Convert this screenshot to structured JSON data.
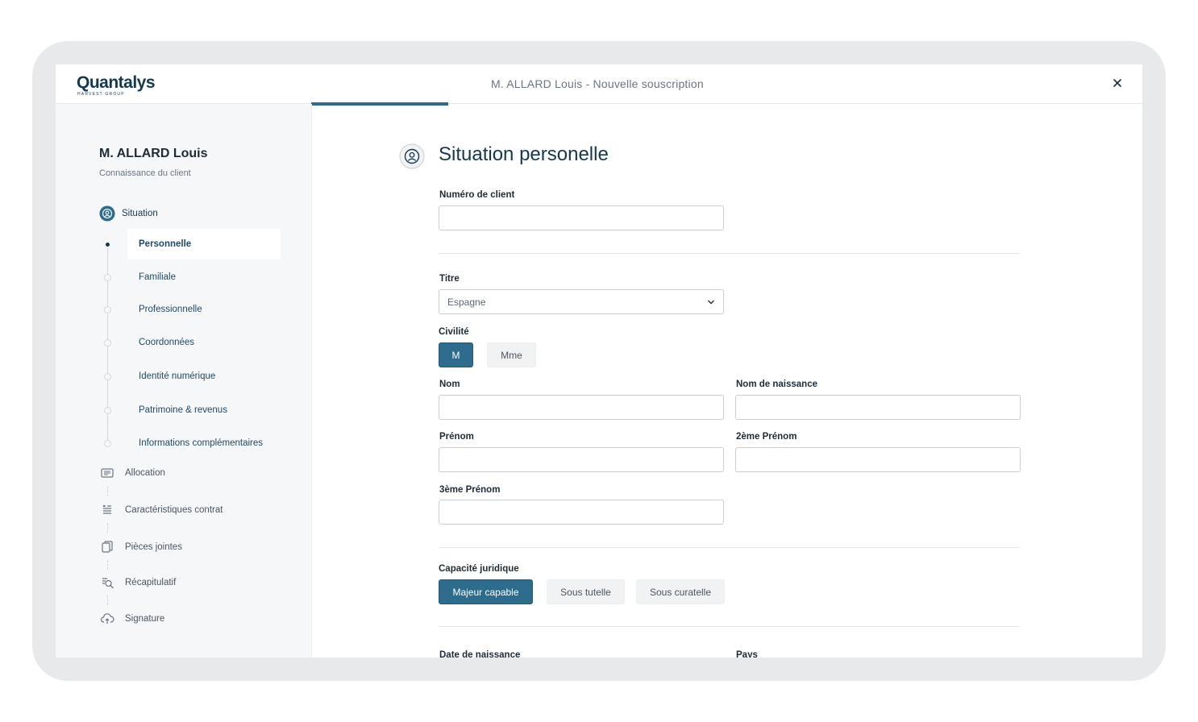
{
  "app": {
    "logo_text": "Quantalys",
    "logo_sub": "HARVEST GROUP",
    "window_title": "M. ALLARD Louis - Nouvelle souscription",
    "progress": 0.165
  },
  "sidebar": {
    "client_name": "M. ALLARD Louis",
    "client_subtitle": "Connaissance du client",
    "situation_label": "Situation",
    "sub_items": [
      {
        "label": "Personnelle",
        "active": true
      },
      {
        "label": "Familiale"
      },
      {
        "label": "Professionnelle"
      },
      {
        "label": "Coordonnées"
      },
      {
        "label": "Identité numérique"
      },
      {
        "label": "Patrimoine & revenus"
      },
      {
        "label": "Informations complémentaires"
      }
    ],
    "steps": [
      {
        "label": "Allocation",
        "icon": "allocation-icon"
      },
      {
        "label": "Caractéristiques contrat",
        "icon": "contract-list-icon"
      },
      {
        "label": "Pièces jointes",
        "icon": "attachments-icon"
      },
      {
        "label": "Récapitulatif",
        "icon": "summary-search-icon"
      },
      {
        "label": "Signature",
        "icon": "cloud-upload-icon"
      }
    ]
  },
  "form": {
    "section_title": "Situation personelle",
    "numero_client_label": "Numéro de client",
    "numero_client_value": "",
    "titre_label": "Titre",
    "titre_value": "Espagne",
    "civilite_label": "Civilité",
    "civilite_options": [
      "M",
      "Mme"
    ],
    "civilite_selected": "M",
    "nom_label": "Nom",
    "nom_naissance_label": "Nom de naissance",
    "prenom_label": "Prénom",
    "prenom2_label": "2ème Prénom",
    "prenom3_label": "3ème Prénom",
    "capacite_label": "Capacité juridique",
    "capacite_options": [
      "Majeur capable",
      "Sous tutelle",
      "Sous curatelle"
    ],
    "capacite_selected": "Majeur capable",
    "date_naissance_label": "Date de naissance",
    "pays_label": "Pays"
  },
  "colors": {
    "brand": "#14394f",
    "accent": "#2e6c8e",
    "frame": "#e8e9eb"
  }
}
